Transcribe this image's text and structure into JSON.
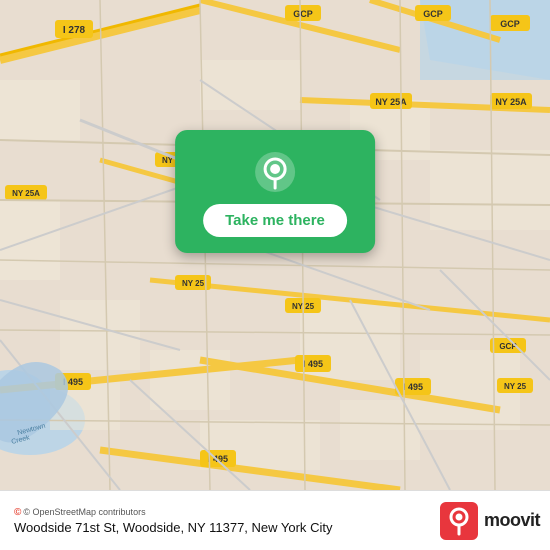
{
  "map": {
    "alt": "Map of Woodside 71st St area, Queens, New York",
    "background_color": "#e8e0d8"
  },
  "button": {
    "label": "Take me there"
  },
  "attribution": {
    "text": "© OpenStreetMap contributors"
  },
  "address": {
    "line1": "Woodside 71st St, Woodside, NY 11377, New York",
    "line2": "City"
  },
  "moovit": {
    "wordmark": "moovit"
  },
  "icons": {
    "location_pin": "📍",
    "osm_logo": "©"
  }
}
